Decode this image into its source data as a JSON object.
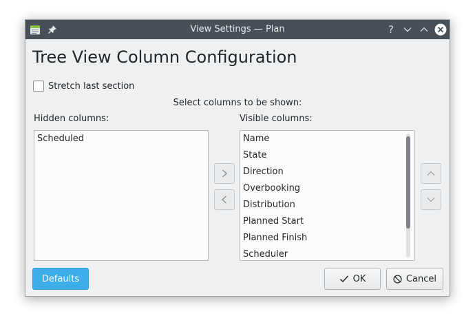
{
  "window": {
    "title": "View Settings — Plan",
    "help_glyph": "?"
  },
  "heading": "Tree View Column Configuration",
  "stretch_checkbox": {
    "label": "Stretch last section",
    "checked": false
  },
  "select_label": "Select columns to be shown:",
  "hidden_columns": {
    "label": "Hidden columns:",
    "items": [
      "Scheduled"
    ]
  },
  "visible_columns": {
    "label": "Visible columns:",
    "items": [
      "Name",
      "State",
      "Direction",
      "Overbooking",
      "Distribution",
      "Planned Start",
      "Planned Finish",
      "Scheduler"
    ]
  },
  "buttons": {
    "defaults": "Defaults",
    "ok": "OK",
    "cancel": "Cancel"
  },
  "icons": {
    "app": "calendar-app-icon",
    "pin": "pin-icon",
    "move_right": "chevron-right-icon",
    "move_left": "chevron-left-icon",
    "move_up": "chevron-up-icon",
    "move_down": "chevron-down-icon",
    "ok": "checkmark-icon",
    "cancel": "cancel-circle-icon"
  },
  "colors": {
    "titlebar": "#475057",
    "accent": "#3daee9",
    "window_bg": "#eff0f1"
  }
}
